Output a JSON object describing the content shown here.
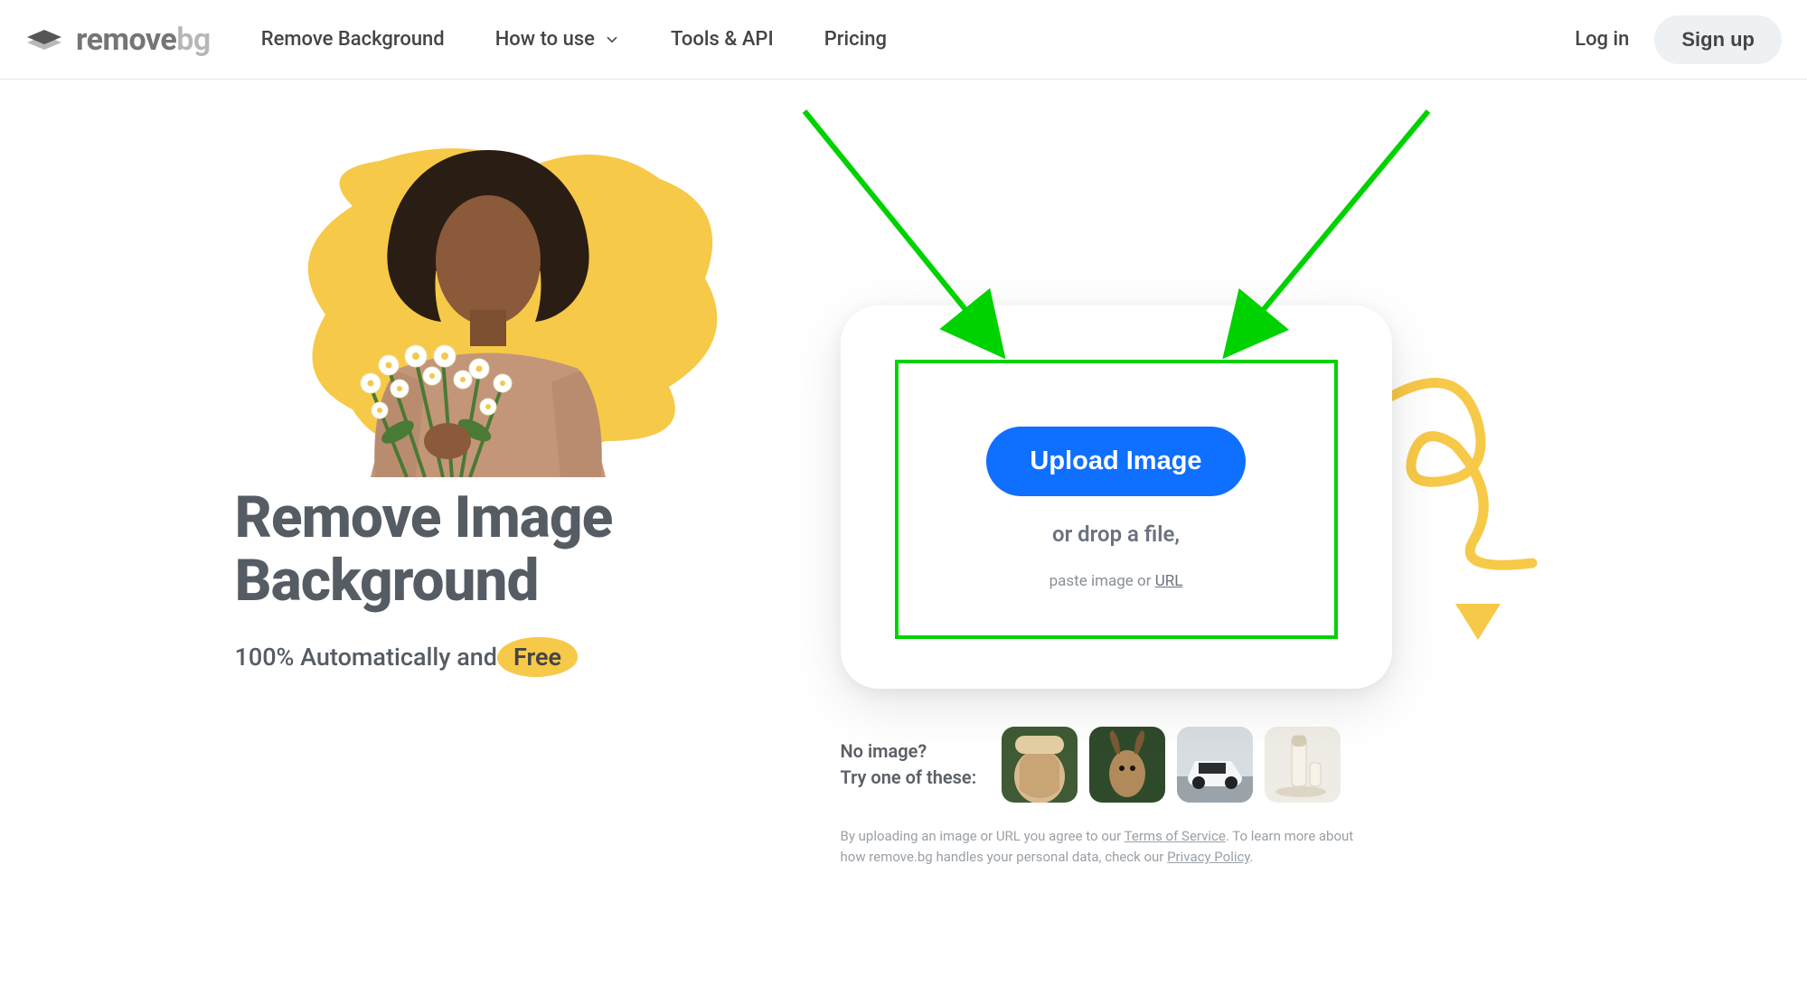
{
  "header": {
    "logo_text": "remove",
    "logo_bg": "bg",
    "nav": {
      "remove_background": "Remove Background",
      "how_to_use": "How to use",
      "tools_api": "Tools & API",
      "pricing": "Pricing"
    },
    "login": "Log in",
    "signup": "Sign up"
  },
  "hero": {
    "headline_line1": "Remove Image",
    "headline_line2": "Background",
    "subhead_prefix": "100% Automatically and",
    "free": "Free"
  },
  "upload": {
    "button": "Upload Image",
    "drop": "or drop a file,",
    "paste_prefix": "paste image or ",
    "url": "URL"
  },
  "samples": {
    "line1": "No image?",
    "line2": "Try one of these:"
  },
  "legal": {
    "prefix": "By uploading an image or URL you agree to our ",
    "tos": "Terms of Service",
    "mid": ". To learn more about how remove.bg handles your personal data, check our ",
    "privacy": "Privacy Policy",
    "suffix": "."
  },
  "colors": {
    "accent_blue": "#0f6fff",
    "accent_yellow": "#f7c948",
    "annotation_green": "#00d200"
  }
}
